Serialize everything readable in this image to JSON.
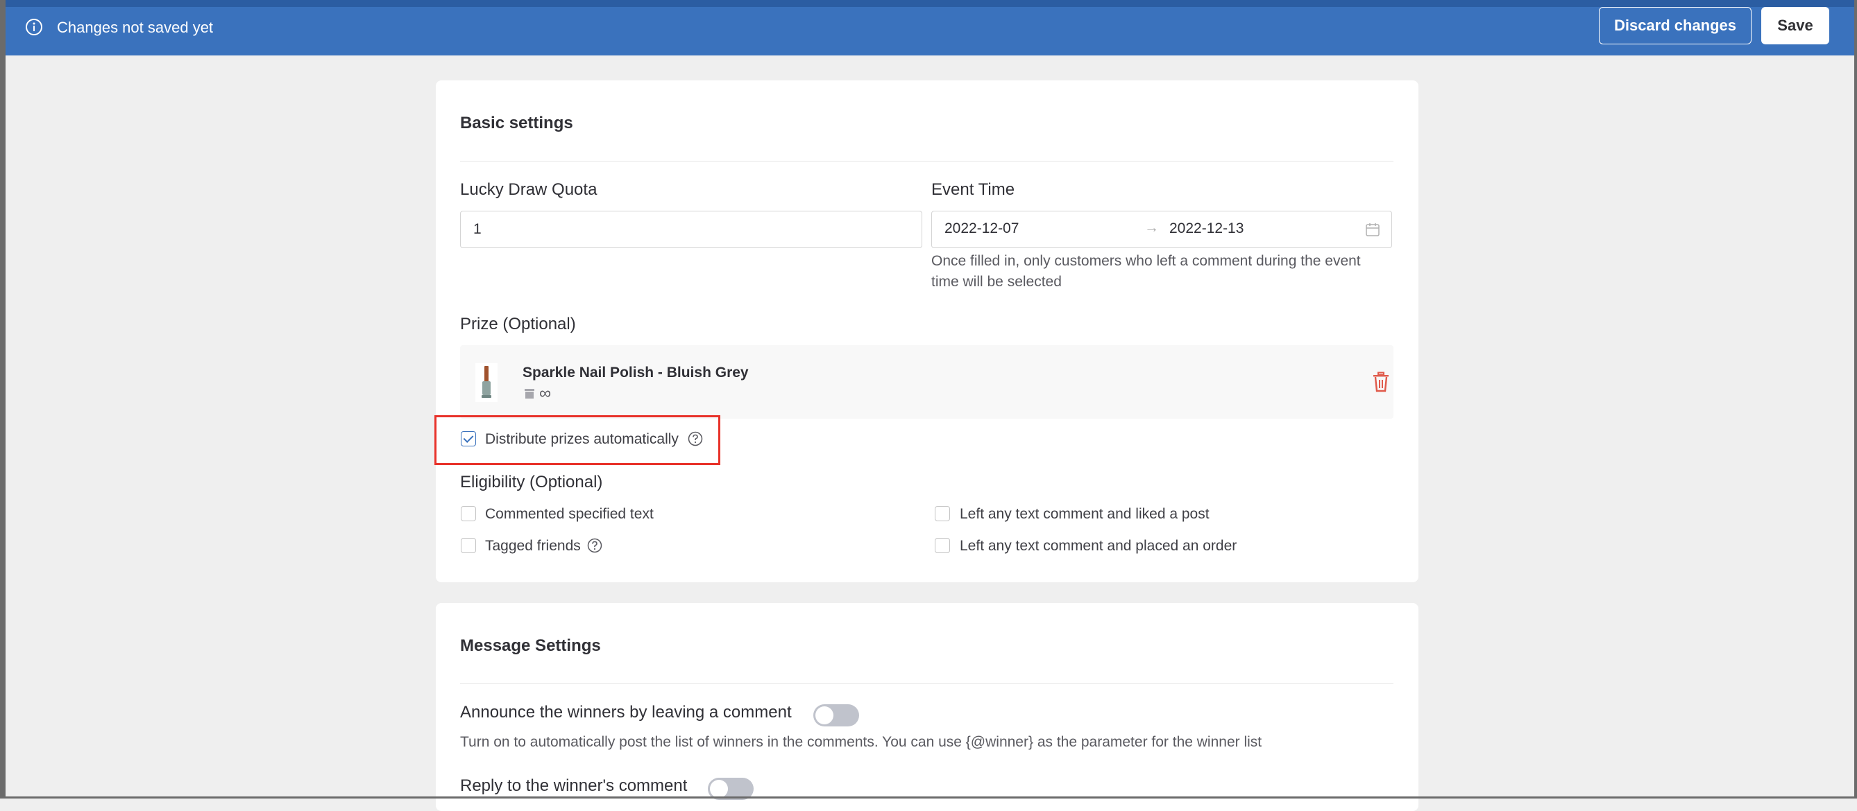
{
  "topbar": {
    "status_text": "Changes not saved yet",
    "discard_label": "Discard changes",
    "save_label": "Save",
    "color": "#3a72bd"
  },
  "basic_settings": {
    "title": "Basic settings",
    "quota": {
      "label": "Lucky Draw Quota",
      "value": "1"
    },
    "event_time": {
      "label": "Event Time",
      "start": "2022-12-07",
      "separator": "→",
      "end": "2022-12-13",
      "help": "Once filled in, only customers who left a comment during the event time will be selected"
    },
    "prize": {
      "label": "Prize (Optional)",
      "name": "Sparkle Nail Polish - Bluish Grey",
      "stock": "∞"
    },
    "distribute": {
      "label": "Distribute prizes automatically",
      "checked": true
    },
    "eligibility": {
      "label": "Eligibility (Optional)",
      "options": [
        {
          "label": "Commented specified text",
          "checked": false
        },
        {
          "label": "Left any text comment and liked a post",
          "checked": false
        },
        {
          "label": "Tagged friends",
          "checked": false
        },
        {
          "label": "Left any text comment and placed an order",
          "checked": false
        }
      ]
    }
  },
  "message_settings": {
    "title": "Message Settings",
    "announce": {
      "label": "Announce the winners by leaving a comment",
      "enabled": false,
      "help": "Turn on to automatically post the list of winners in the comments. You can use {@winner} as the parameter for the winner list"
    },
    "reply": {
      "label": "Reply to the winner's comment",
      "enabled": false
    }
  },
  "colors": {
    "accent": "#3a72bd",
    "highlight": "#e8322a",
    "delete": "#e05a4b"
  }
}
